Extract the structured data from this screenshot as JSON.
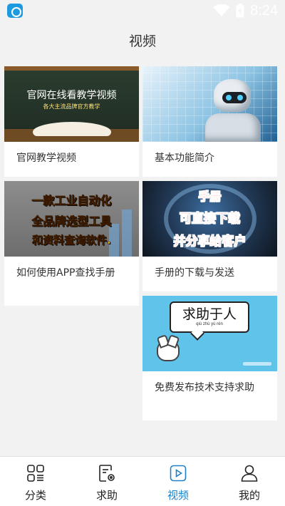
{
  "status_bar": {
    "time": "8:24",
    "icons": [
      "app-icon",
      "wifi-icon",
      "battery-charging-icon"
    ]
  },
  "header": {
    "title": "视频"
  },
  "videos": [
    {
      "title": "官网教学视频",
      "thumbnail_lines": [
        "官网在线看教学视频",
        "各大主流品牌官方教学"
      ]
    },
    {
      "title": "基本功能简介",
      "thumbnail_lines": []
    },
    {
      "title": "如何使用APP查找手册",
      "thumbnail_lines": [
        "一款工业自动化",
        "全品牌选型工具",
        "和资料查询软件."
      ]
    },
    {
      "title": "手册的下载与发送",
      "thumbnail_lines": [
        "手册",
        "可直接下载",
        "并分享给客户"
      ]
    },
    {
      "title": "免费发布技术支持求助",
      "thumbnail_lines": [
        "求助于人",
        "qiú zhù yú rén"
      ]
    }
  ],
  "tab_bar": {
    "active": "视频",
    "tabs": [
      {
        "label": "分类",
        "icon": "category-grid-icon"
      },
      {
        "label": "求助",
        "icon": "help-request-icon"
      },
      {
        "label": "视频",
        "icon": "video-play-icon"
      },
      {
        "label": "我的",
        "icon": "profile-icon"
      }
    ]
  },
  "colors": {
    "accent": "#1e82c8",
    "background": "#f2f2f2"
  }
}
